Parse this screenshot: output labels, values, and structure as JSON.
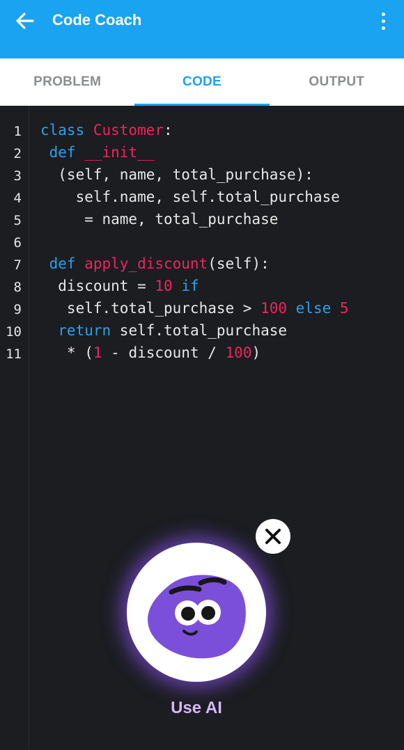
{
  "app_bar": {
    "title": "Code Coach",
    "back_icon": "arrow-left-icon",
    "menu_icon": "more-vertical-icon",
    "color": "#1aa3f0"
  },
  "tabs": [
    {
      "label": "PROBLEM",
      "active": false
    },
    {
      "label": "CODE",
      "active": true
    },
    {
      "label": "OUTPUT",
      "active": false
    }
  ],
  "editor": {
    "line_numbers": [
      "1",
      "2",
      "3",
      "4",
      "5",
      "6",
      "7",
      "8",
      "9",
      "10",
      "11"
    ],
    "lines": [
      [
        {
          "t": "class ",
          "c": "kw"
        },
        {
          "t": "Customer",
          "c": "nm"
        },
        {
          "t": ":",
          "c": ""
        }
      ],
      [
        {
          "t": " def ",
          "c": "kw"
        },
        {
          "t": "__init__",
          "c": "nm"
        }
      ],
      [
        {
          "t": "  (self, name, total_purchase):",
          "c": ""
        }
      ],
      [
        {
          "t": "    self.name, self.total_purchase",
          "c": ""
        }
      ],
      [
        {
          "t": "     = name, total_purchase",
          "c": ""
        }
      ],
      [],
      [
        {
          "t": " def ",
          "c": "kw"
        },
        {
          "t": "apply_discount",
          "c": "nm"
        },
        {
          "t": "(self):",
          "c": ""
        }
      ],
      [
        {
          "t": "  discount = ",
          "c": ""
        },
        {
          "t": "10",
          "c": "nm"
        },
        {
          "t": " if",
          "c": "kw"
        }
      ],
      [
        {
          "t": "   self.total_purchase > ",
          "c": ""
        },
        {
          "t": "100",
          "c": "nm"
        },
        {
          "t": " else",
          "c": "kw"
        },
        {
          "t": " ",
          "c": ""
        },
        {
          "t": "5",
          "c": "nm"
        }
      ],
      [
        {
          "t": "  return",
          "c": "kw"
        },
        {
          "t": " self.total_purchase",
          "c": ""
        }
      ],
      [
        {
          "t": "   * (",
          "c": ""
        },
        {
          "t": "1",
          "c": "nm"
        },
        {
          "t": " - discount / ",
          "c": ""
        },
        {
          "t": "100",
          "c": "nm"
        },
        {
          "t": ")",
          "c": ""
        }
      ]
    ]
  },
  "ai_button": {
    "label": "Use AI",
    "close_icon": "close-icon",
    "mascot_icon": "ai-mascot-icon"
  }
}
